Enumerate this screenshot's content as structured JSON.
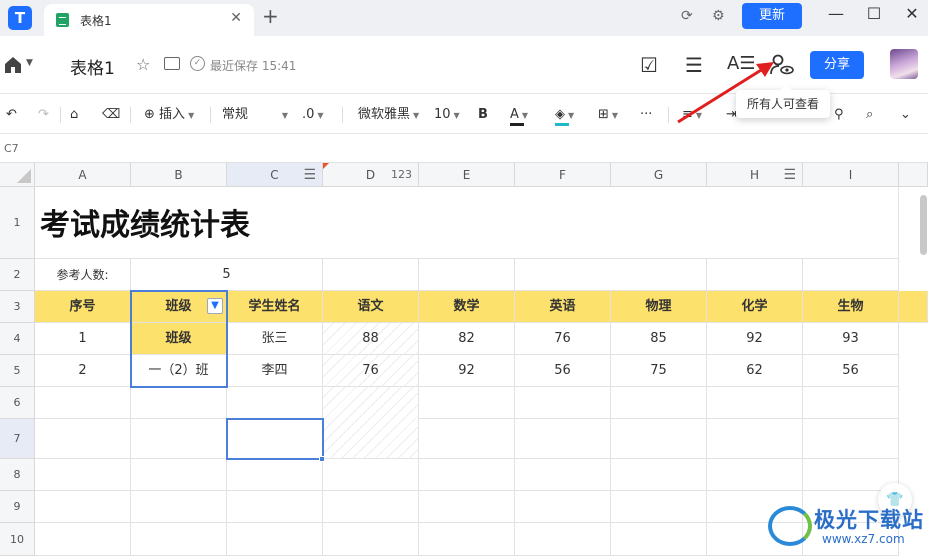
{
  "window": {
    "tab_title": "表格1",
    "update_label": "更新",
    "icons": [
      "app-logo",
      "sheet-icon",
      "close-icon",
      "plus-icon",
      "sync-icon",
      "settings-icon",
      "minimize-icon",
      "maximize-icon",
      "close-window-icon"
    ]
  },
  "header": {
    "doc_title": "表格1",
    "save_status": "最近保存 15:41",
    "share_label": "分享",
    "tooltip": "所有人可查看",
    "accent": "#1e6fff"
  },
  "toolbar": {
    "insert_label": "插入",
    "format_label": "常规",
    "decimal_label": ".0",
    "font_label": "微软雅黑",
    "size_label": "10",
    "bold_label": "B",
    "font_color_label": "A",
    "more_label": "···"
  },
  "sheet": {
    "cell_ref": "C7",
    "columns": [
      "A",
      "B",
      "C",
      "D",
      "E",
      "F",
      "G",
      "H",
      "I"
    ],
    "col_d_type": "123",
    "rows": [
      "1",
      "2",
      "3",
      "4",
      "5",
      "6",
      "7",
      "8",
      "9",
      "10"
    ],
    "title": "考试成绩统计表",
    "participants_label": "参考人数:",
    "participants_value": "5",
    "headers": [
      "序号",
      "班级",
      "学生姓名",
      "语文",
      "数学",
      "英语",
      "物理",
      "化学",
      "生物"
    ],
    "records": [
      [
        "1",
        "班级",
        "张三",
        "88",
        "82",
        "76",
        "85",
        "92",
        "93"
      ],
      [
        "2",
        "一（2）班",
        "李四",
        "76",
        "92",
        "56",
        "75",
        "62",
        "56"
      ]
    ],
    "header_color": "#fde16d",
    "filter_icon": "filter-icon"
  },
  "watermark": {
    "name": "极光下载站",
    "url": "www.xz7.com"
  }
}
